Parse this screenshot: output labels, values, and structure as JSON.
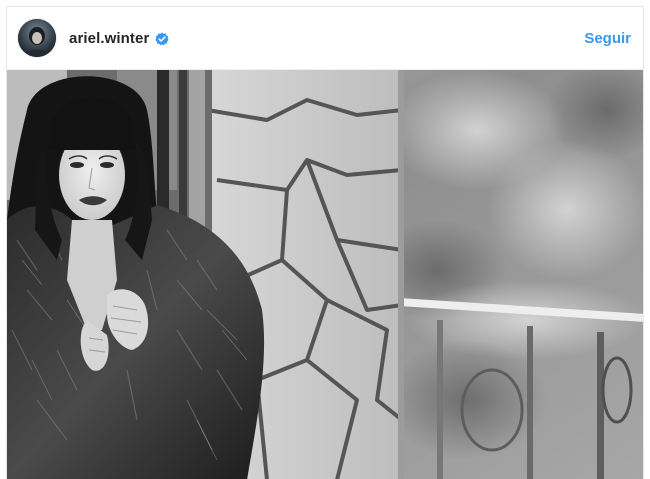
{
  "post": {
    "username": "ariel.winter",
    "verified_icon": "verified-badge-icon",
    "follow_label": "Seguir",
    "accent_color": "#3897f0"
  },
  "photo": {
    "subject": "black-and-white portrait",
    "style": "grayscale"
  }
}
